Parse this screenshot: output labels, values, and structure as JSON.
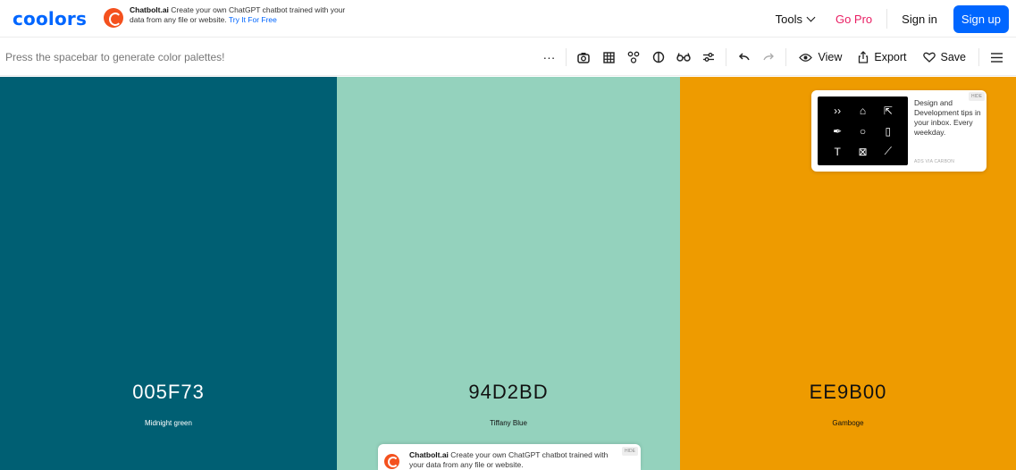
{
  "header": {
    "logo": "coolors",
    "ad": {
      "brand": "Chatbolt.ai",
      "text": "Create your own ChatGPT chatbot trained with your data from any file or website.",
      "cta": "Try It For Free"
    },
    "nav": {
      "tools": "Tools",
      "go_pro": "Go Pro",
      "sign_in": "Sign in",
      "sign_up": "Sign up"
    }
  },
  "toolbar": {
    "hint": "Press the spacebar to generate color palettes!",
    "icons": [
      "more-icon",
      "camera-icon",
      "grid-icon",
      "layout-icon",
      "contrast-icon",
      "glasses-icon",
      "adjust-icon",
      "undo-icon",
      "redo-icon"
    ],
    "view_label": "View",
    "export_label": "Export",
    "save_label": "Save"
  },
  "palette": {
    "colors": [
      {
        "hex": "005F73",
        "name": "Midnight green",
        "bg": "#005F73",
        "fg": "#ffffff"
      },
      {
        "hex": "94D2BD",
        "name": "Tiffany Blue",
        "bg": "#94D2BD",
        "fg": "#111111"
      },
      {
        "hex": "EE9B00",
        "name": "Gamboge",
        "bg": "#EE9B00",
        "fg": "#111111"
      }
    ]
  },
  "carbon_ad": {
    "text": "Design and Development tips in your inbox. Every weekday.",
    "via": "ADS VIA CARBON",
    "hide": "HIDE"
  },
  "bottom_ad": {
    "brand": "Chatbolt.ai",
    "text": "Create your own ChatGPT chatbot trained with your data from any file or website.",
    "hide": "HIDE"
  },
  "colors": {
    "accent": "#0066ff",
    "go_pro": "#e91e63"
  }
}
